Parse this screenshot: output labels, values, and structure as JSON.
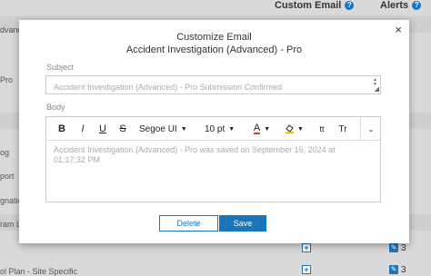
{
  "background": {
    "columns": {
      "custom_email": "Custom Email",
      "alerts": "Alerts"
    },
    "row_labels": [
      "dvanc",
      "Pro",
      "og",
      "port",
      "gnatio",
      "ram L",
      "ol Plan - Site Specific"
    ],
    "alert_counts": [
      "3",
      "3"
    ]
  },
  "modal": {
    "title": "Customize Email",
    "subtitle": "Accident Investigation (Advanced) - Pro",
    "close_label": "×",
    "subject": {
      "label": "Subject",
      "placeholder": "Accident Investigation (Advanced) - Pro Submission Confirmed"
    },
    "body": {
      "label": "Body",
      "placeholder": "Accident Investigation (Advanced) - Pro was saved on September 16, 2024 at 01:17:32 PM"
    },
    "toolbar": {
      "bold": "B",
      "italic": "I",
      "underline": "U",
      "strikethrough": "S",
      "font_family": "Segoe UI",
      "font_size": "10 pt",
      "font_color": "A",
      "font_color_accent": "#e53935",
      "highlight_accent": "#f2c200",
      "superscript": "tt",
      "text_case": "Tr"
    },
    "buttons": {
      "delete": "Delete",
      "save": "Save"
    }
  }
}
